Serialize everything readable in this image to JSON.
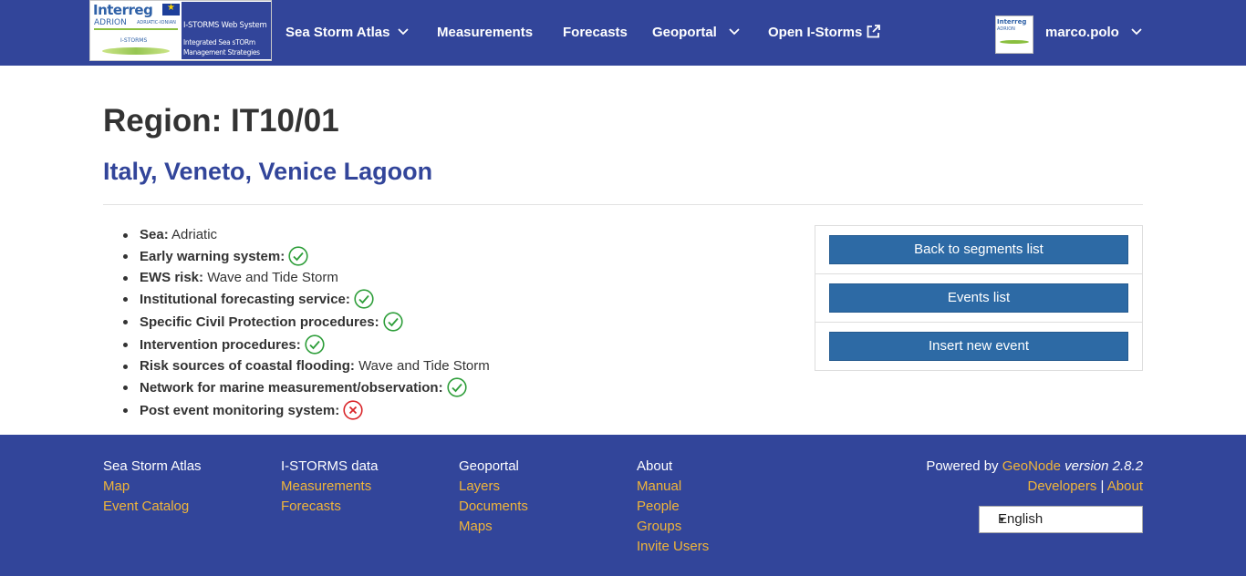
{
  "header": {
    "logo": {
      "interreg": "Interreg",
      "adrion": "ADRION",
      "adriatic_ionian": "ADRIATIC-IONIAN",
      "istorms_small": "I-STORMS",
      "system_line1": "I-STORMS Web System",
      "system_line2": "Integrated Sea sTORm",
      "system_line3": "Management Strategies"
    },
    "nav": [
      {
        "label": "Sea Storm Atlas",
        "dropdown": true
      },
      {
        "label": "Measurements",
        "dropdown": false
      },
      {
        "label": "Forecasts",
        "dropdown": false
      },
      {
        "label": "Geoportal",
        "dropdown": true
      },
      {
        "label": "Open I-Storms",
        "dropdown": false,
        "icon": "external-link-icon"
      }
    ],
    "user": {
      "name": "marco.polo",
      "dropdown": true
    },
    "colors": {
      "navbar": "#32459a",
      "link": "#f0b53a",
      "button": "#2d6aa5"
    }
  },
  "main": {
    "title": "Region: IT10/01",
    "subtitle": "Italy, Veneto, Venice Lagoon",
    "properties": [
      {
        "label": "Sea:",
        "value": "Adriatic"
      },
      {
        "label": "Early warning system:",
        "status": "check-circle-icon"
      },
      {
        "label": "EWS risk:",
        "value": "Wave and Tide Storm"
      },
      {
        "label": "Institutional forecasting service:",
        "status": "check-circle-icon"
      },
      {
        "label": "Specific Civil Protection procedures:",
        "status": "check-circle-icon"
      },
      {
        "label": "Intervention procedures:",
        "status": "check-circle-icon"
      },
      {
        "label": "Risk sources of coastal flooding:",
        "value": "Wave and Tide Storm"
      },
      {
        "label": "Network for marine measurement/observation:",
        "status": "check-circle-icon"
      },
      {
        "label": "Post event monitoring system:",
        "status": "cross-circle-icon"
      }
    ],
    "actions": {
      "back": "Back to segments list",
      "events": "Events list",
      "insert": "Insert new event"
    }
  },
  "footer": {
    "columns": [
      {
        "heading": "Sea Storm Atlas",
        "links": [
          "Map",
          "Event Catalog"
        ]
      },
      {
        "heading": "I-STORMS data",
        "links": [
          "Measurements",
          "Forecasts"
        ]
      },
      {
        "heading": "Geoportal",
        "links": [
          "Layers",
          "Documents",
          "Maps"
        ]
      },
      {
        "heading": "About",
        "links": [
          "Manual",
          "People",
          "Groups",
          "Invite Users"
        ]
      }
    ],
    "powered_by": "Powered by",
    "geonode": "GeoNode",
    "version": "version 2.8.2",
    "developers": "Developers",
    "separator": "|",
    "about": "About",
    "language": "English"
  }
}
